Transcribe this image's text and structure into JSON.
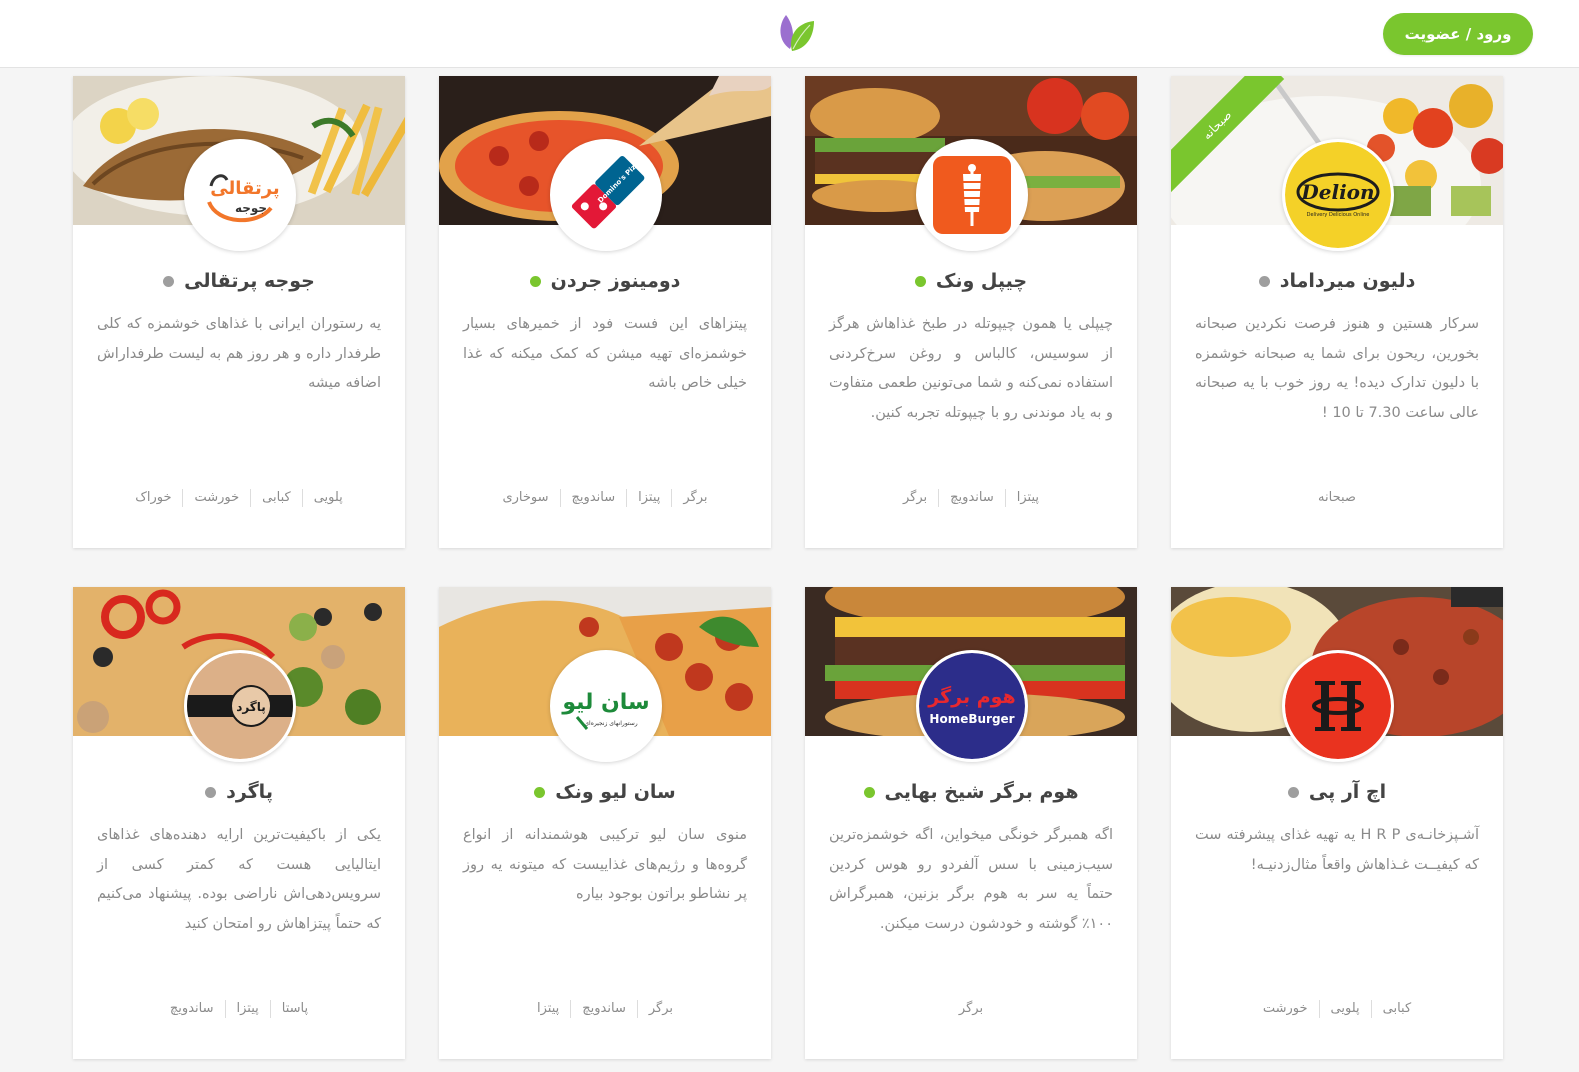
{
  "header": {
    "login_label": "ورود / عضویت",
    "logo_icon": "leaf-logo-icon"
  },
  "colors": {
    "accent": "#7ac62e",
    "status_open": "#7ac62e",
    "status_closed": "#9e9e9e"
  },
  "restaurants": [
    {
      "name": "دلیون میرداماد",
      "status": "closed",
      "ribbon": "صبحانه",
      "logo_icon": "delion-logo-icon",
      "logo_text": "Delion",
      "logo_subtext": "Delivery Delicious Online",
      "description": "سرکار هستین و هنوز فرصت نکردین صبحانه بخورین، ریحون برای شما یه صبحانه خوشمزه با دلیون تدارک دیده! یه روز خوب با یه صبحانه عالی ساعت 7.30 تا 10 !",
      "tags": [
        "صبحانه"
      ]
    },
    {
      "name": "چیپل ونک",
      "status": "open",
      "logo_icon": "chipel-logo-icon",
      "description": "چیپلی یا همون چیپوتله در طبخ غذاهاش هرگز از سوسیس، کالباس و روغن سرخ‌کردنی استفاده نمی‌کنه و شما می‌تونین طعمی متفاوت و به یاد موندنی رو با چیپوتله تجربه کنین.",
      "tags": [
        "پیتزا",
        "ساندویچ",
        "برگر"
      ]
    },
    {
      "name": "دومینوز جردن",
      "status": "open",
      "logo_icon": "dominos-logo-icon",
      "logo_text": "Domino's Pizza",
      "description": "پیتزاهای این فست فود از خمیرهای بسیار خوشمزه‌ای تهیه میشن که کمک میکنه که غذا خیلی خاص باشه",
      "tags": [
        "برگر",
        "پیتزا",
        "ساندویچ",
        "سوخاری"
      ]
    },
    {
      "name": "جوجه پرتقالی",
      "status": "closed",
      "logo_icon": "joojeh-portghali-logo-icon",
      "logo_text": "پرتقالی",
      "logo_subtext": "جوجه",
      "description": "یه رستوران ایرانی با غذاهای خوشمزه که کلی طرفدار داره و هر روز هم به لیست طرفداراش اضافه میشه",
      "tags": [
        "پلویی",
        "کبابی",
        "خورشت",
        "خوراک"
      ]
    },
    {
      "name": "اچ آر پی",
      "status": "closed",
      "logo_icon": "hrp-logo-icon",
      "description": "آشـپزخانـه‌ی H R P یه تهیه غذای پیشرفته ست که کیفیــت غـذاهاش واقعاً مثال‌زدنیـه!",
      "tags": [
        "کبابی",
        "پلویی",
        "خورشت"
      ]
    },
    {
      "name": "هوم برگر شیخ بهایی",
      "status": "open",
      "logo_icon": "home-burger-logo-icon",
      "logo_text": "هوم برگر",
      "logo_subtext": "HomeBurger",
      "description": "اگه همبرگر خونگی میخواین، اگه خوشمزه‌ترین سیب‌زمینی با سس آلفردو رو هوس کردین حتماً یه سر به هوم برگر بزنین، همبرگراش ۱۰۰٪ گوشته و خودشون درست میکنن.",
      "tags": [
        "برگر"
      ]
    },
    {
      "name": "سان لیو ونک",
      "status": "open",
      "logo_icon": "sunleo-logo-icon",
      "logo_text": "سان لیو",
      "logo_subtext": "رستورانهای زنجیره‌ای",
      "description": "منوی سان لیو ترکیبی هوشمندانه از انواع گروه‌ها و رژیم‌های غذاییست که میتونه یه روز پر نشاطو براتون بوجود بیاره",
      "tags": [
        "برگر",
        "ساندویچ",
        "پیتزا"
      ]
    },
    {
      "name": "پاگرد",
      "status": "closed",
      "logo_icon": "pagard-logo-icon",
      "logo_text": "پاگرد",
      "description": "یکی از باکیفیت‌ترین ارایه دهنده‌های غذاهای ایتالیایی هست که کمتر کسی از سرویس‌دهی‌اش ناراضی بوده. پیشنهاد می‌کنیم که حتماً پیتزاهاش رو امتحان کنید",
      "tags": [
        "پاستا",
        "پیتزا",
        "ساندویچ"
      ]
    }
  ]
}
